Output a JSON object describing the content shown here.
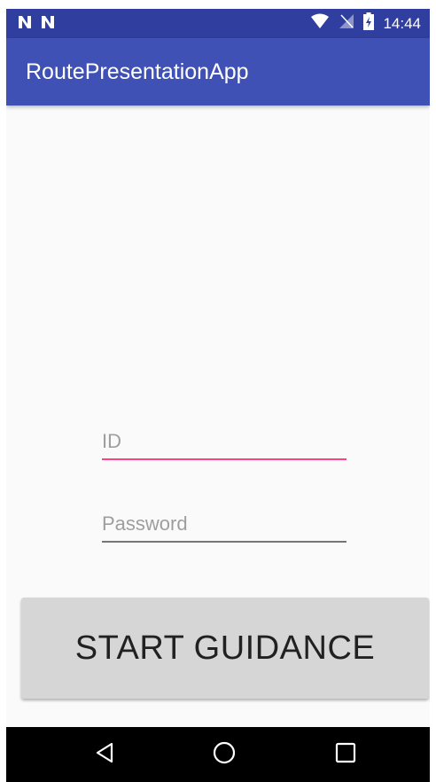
{
  "status_bar": {
    "time": "14:44",
    "left_icons": [
      "n-notification-icon",
      "n-notification-icon"
    ],
    "right_icons": [
      "wifi-icon",
      "no-signal-icon",
      "battery-charging-icon"
    ]
  },
  "app_bar": {
    "title": "RoutePresentationApp"
  },
  "form": {
    "id_placeholder": "ID",
    "id_value": "",
    "password_placeholder": "Password",
    "password_value": ""
  },
  "actions": {
    "start_label": "START GUIDANCE"
  },
  "nav_bar": {
    "items": [
      "back-icon",
      "home-icon",
      "recents-icon"
    ]
  },
  "colors": {
    "primary_dark": "#303f9f",
    "primary": "#3f51b5",
    "accent": "#ff4081",
    "button_bg": "#d6d6d6"
  }
}
